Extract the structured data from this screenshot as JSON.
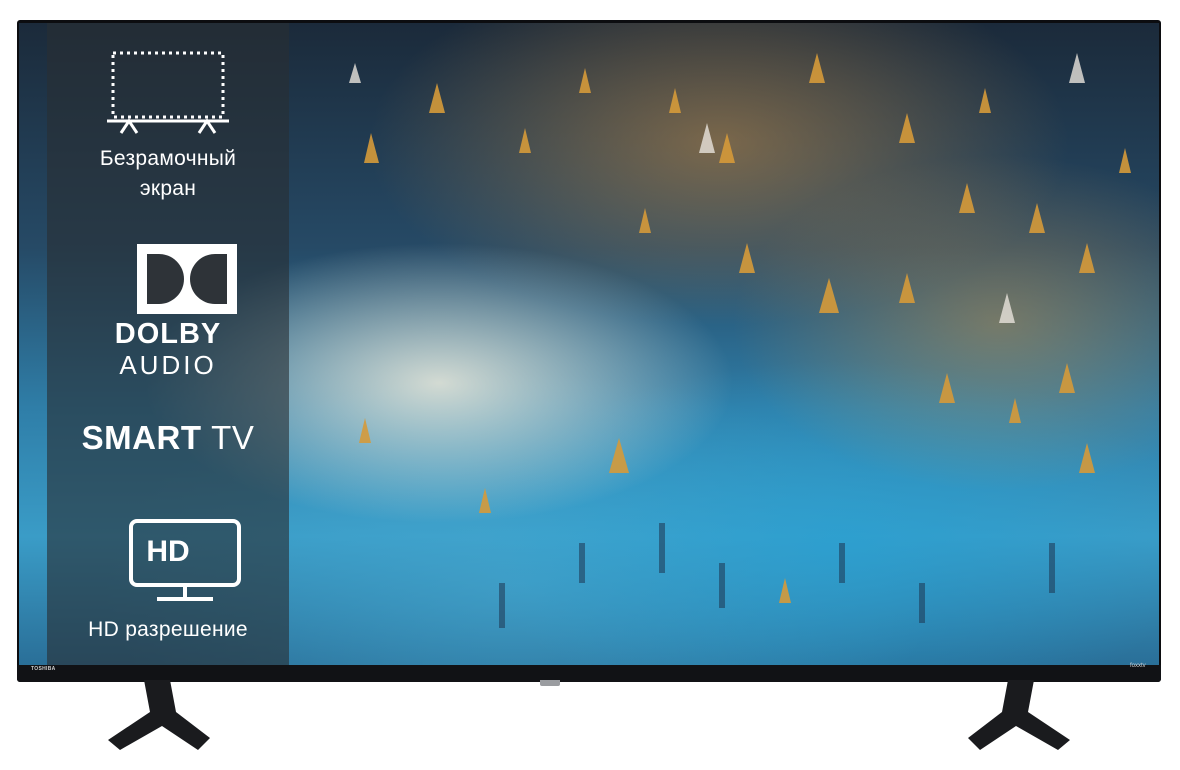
{
  "features": {
    "frameless": {
      "label_line1": "Безрамочный",
      "label_line2": "экран",
      "icon": "frameless-screen-icon"
    },
    "dolby": {
      "line1": "DOLBY",
      "line2": "AUDIO",
      "icon": "dolby-double-d-icon"
    },
    "smart": {
      "smart": "SMART",
      "tv": "TV"
    },
    "hd": {
      "badge": "HD",
      "label": "HD разрешение",
      "icon": "hd-monitor-icon"
    }
  },
  "bezel": {
    "brand": "TOSHIBA",
    "logo_right": "foxxtv"
  },
  "colors": {
    "frame": "#0c0d10",
    "panel": "#2e3338",
    "text": "#ffffff"
  }
}
